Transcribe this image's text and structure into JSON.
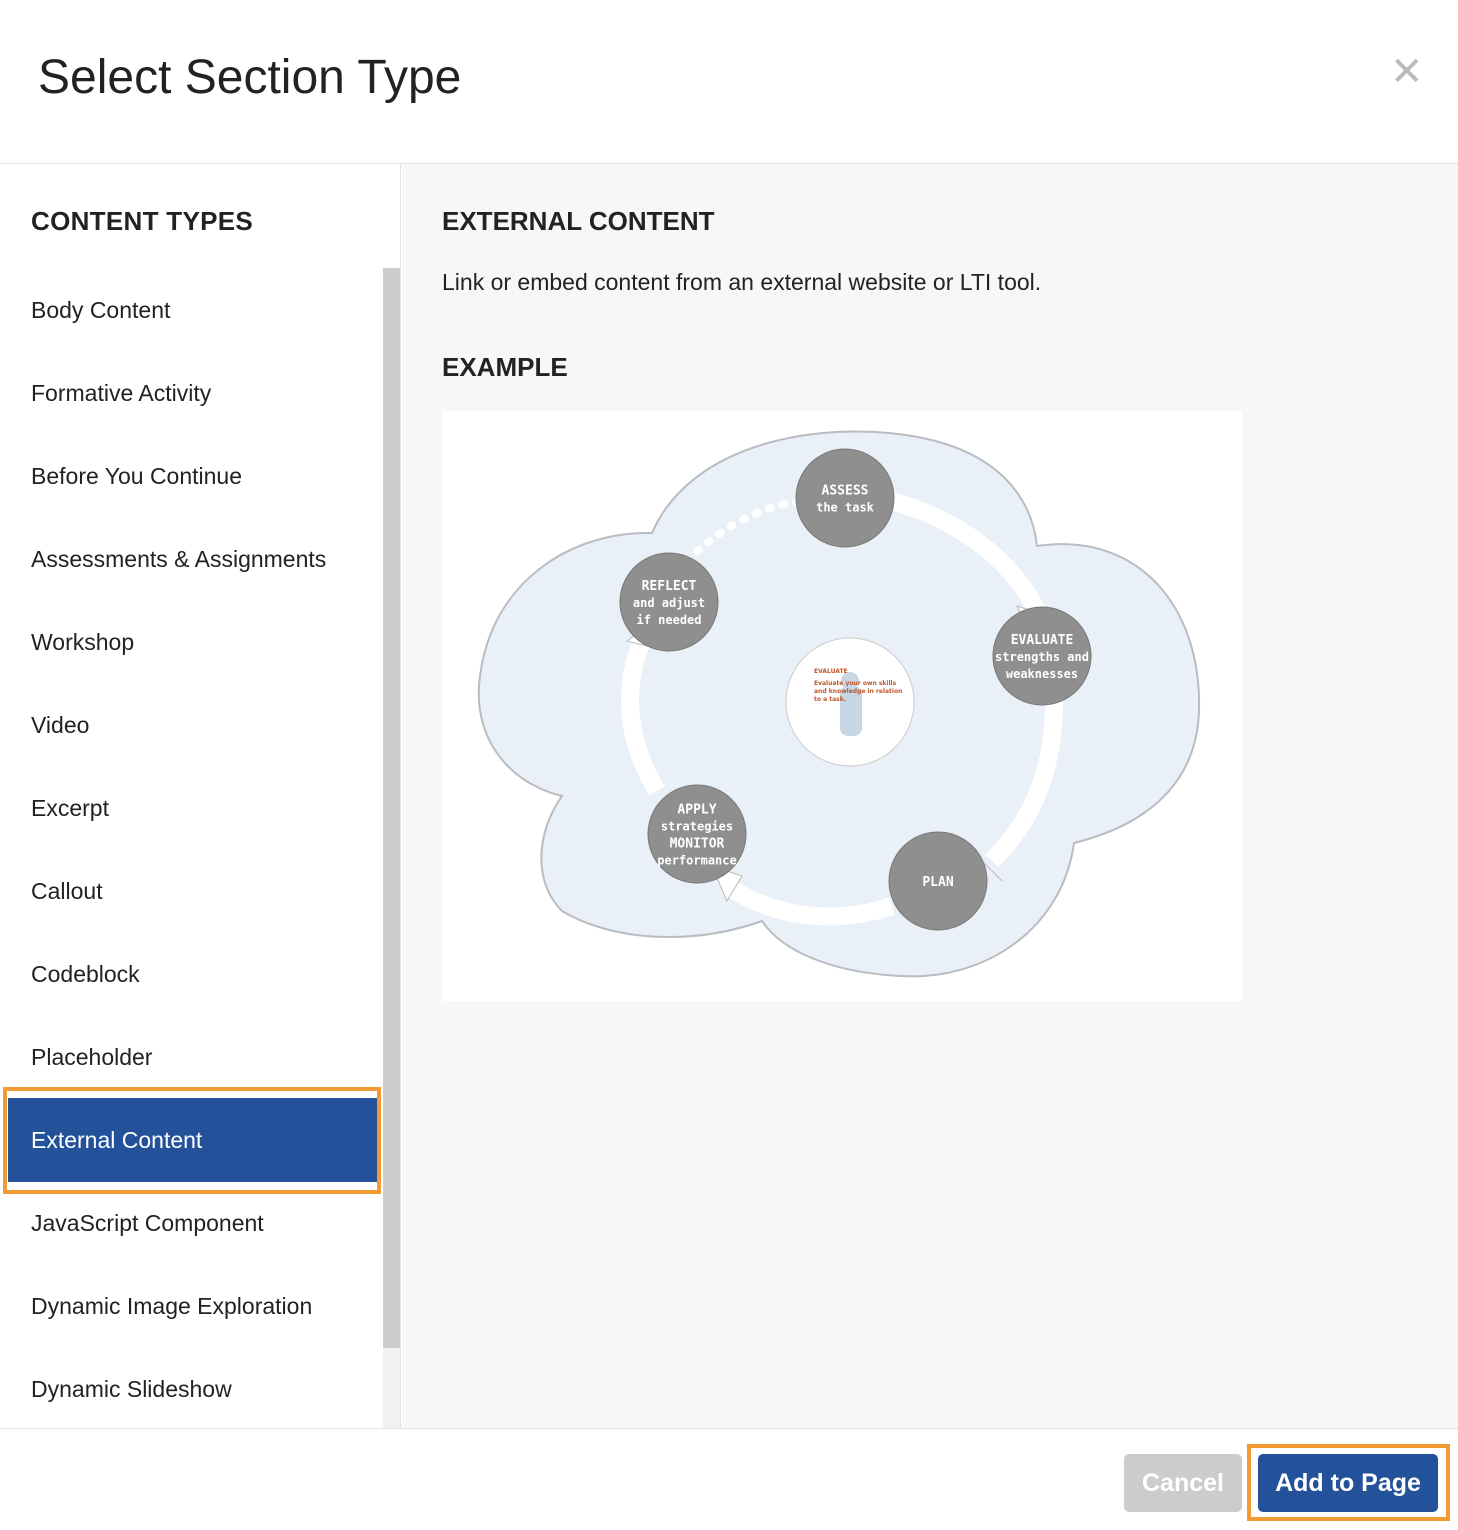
{
  "dialog": {
    "title": "Select Section Type",
    "close_icon": "close-icon"
  },
  "sidebar": {
    "heading": "CONTENT TYPES",
    "selected_index": 10,
    "items": [
      {
        "label": "Body Content"
      },
      {
        "label": "Formative Activity"
      },
      {
        "label": "Before You Continue"
      },
      {
        "label": "Assessments & Assignments"
      },
      {
        "label": "Workshop"
      },
      {
        "label": "Video"
      },
      {
        "label": "Excerpt"
      },
      {
        "label": "Callout"
      },
      {
        "label": "Codeblock"
      },
      {
        "label": "Placeholder"
      },
      {
        "label": "External Content"
      },
      {
        "label": "JavaScript Component"
      },
      {
        "label": "Dynamic Image Exploration"
      },
      {
        "label": "Dynamic Slideshow"
      }
    ]
  },
  "detail": {
    "heading": "EXTERNAL CONTENT",
    "description": "Link or embed content from an external website or LTI tool.",
    "example_heading": "EXAMPLE",
    "diagram": {
      "assess": [
        "ASSESS",
        "the task"
      ],
      "evaluate": [
        "EVALUATE",
        "strengths and",
        "weaknesses"
      ],
      "plan": [
        "PLAN"
      ],
      "apply": [
        "APPLY",
        "strategies",
        "MONITOR",
        "performance"
      ],
      "reflect": [
        "REFLECT",
        "and adjust",
        "if needed"
      ],
      "center": [
        "EVALUATE",
        "Evaluate your own skills",
        "and knowledge in relation",
        "to a task."
      ]
    }
  },
  "footer": {
    "cancel_label": "Cancel",
    "add_label": "Add to Page"
  },
  "colors": {
    "accent": "#23529b",
    "highlight": "#f29b34",
    "cancel": "#cccccc"
  }
}
